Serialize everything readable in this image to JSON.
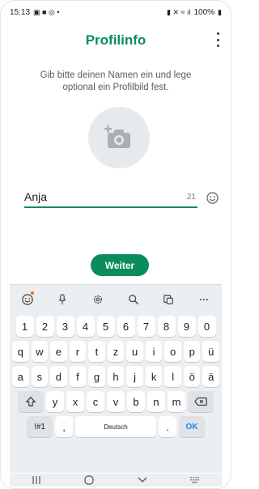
{
  "status": {
    "time": "15:13",
    "battery": "100%"
  },
  "appbar": {
    "title": "Profilinfo"
  },
  "description": "Gib bitte deinen Namen ein und lege optional ein Profilbild fest.",
  "name_field": {
    "value": "Anja",
    "counter": "21"
  },
  "next_button": {
    "label": "Weiter"
  },
  "keyboard": {
    "row_numbers": [
      "1",
      "2",
      "3",
      "4",
      "5",
      "6",
      "7",
      "8",
      "9",
      "0"
    ],
    "row1": [
      "q",
      "w",
      "e",
      "r",
      "t",
      "z",
      "u",
      "i",
      "o",
      "p",
      "ü"
    ],
    "row2": [
      "a",
      "s",
      "d",
      "f",
      "g",
      "h",
      "j",
      "k",
      "l",
      "ö",
      "ä"
    ],
    "row3": [
      "y",
      "x",
      "c",
      "v",
      "b",
      "n",
      "m"
    ],
    "symbols_label": "!#1",
    "comma": ",",
    "space_label": "Deutsch",
    "period": ".",
    "ok_label": "OK",
    "toolbar_more": "···"
  },
  "colors": {
    "accent": "#0a8d5a",
    "ok": "#1e88e5",
    "notification_dot": "#ff6a00"
  },
  "icons": [
    "status-icons",
    "more-options-icon",
    "add-photo-camera-icon",
    "emoji-icon",
    "microphone-icon",
    "settings-icon",
    "search-icon",
    "clipboard-icon",
    "shift-icon",
    "backspace-icon",
    "recent-apps-icon",
    "home-icon",
    "back-icon",
    "keyboard-icon"
  ]
}
